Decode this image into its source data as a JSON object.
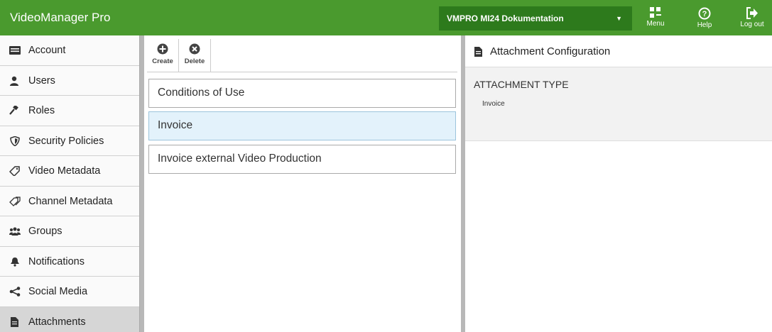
{
  "header": {
    "app_title": "VideoManager Pro",
    "project_select": {
      "value": "VMPRO MI24 Dokumentation"
    },
    "buttons": {
      "menu": "Menu",
      "help": "Help",
      "logout": "Log out"
    }
  },
  "sidebar": {
    "items": [
      {
        "label": "Account",
        "icon": "account-card-icon"
      },
      {
        "label": "Users",
        "icon": "user-icon"
      },
      {
        "label": "Roles",
        "icon": "gavel-icon"
      },
      {
        "label": "Security Policies",
        "icon": "shield-icon"
      },
      {
        "label": "Video Metadata",
        "icon": "tag-icon"
      },
      {
        "label": "Channel Metadata",
        "icon": "tags-icon"
      },
      {
        "label": "Groups",
        "icon": "group-icon"
      },
      {
        "label": "Notifications",
        "icon": "bell-icon"
      },
      {
        "label": "Social Media",
        "icon": "share-icon"
      },
      {
        "label": "Attachments",
        "icon": "document-icon",
        "active": true
      }
    ]
  },
  "toolbar": {
    "create_label": "Create",
    "delete_label": "Delete"
  },
  "list": {
    "items": [
      {
        "label": "Conditions of Use"
      },
      {
        "label": "Invoice",
        "selected": true
      },
      {
        "label": "Invoice external Video Production"
      }
    ]
  },
  "detail": {
    "title": "Attachment Configuration",
    "type_label": "ATTACHMENT TYPE",
    "type_value": "Invoice"
  },
  "colors": {
    "header_bg": "#4a9a2e",
    "select_bg": "#2d7a1c",
    "selected_row": "#e3f2fb",
    "active_sidebar": "#d6d6d6"
  }
}
